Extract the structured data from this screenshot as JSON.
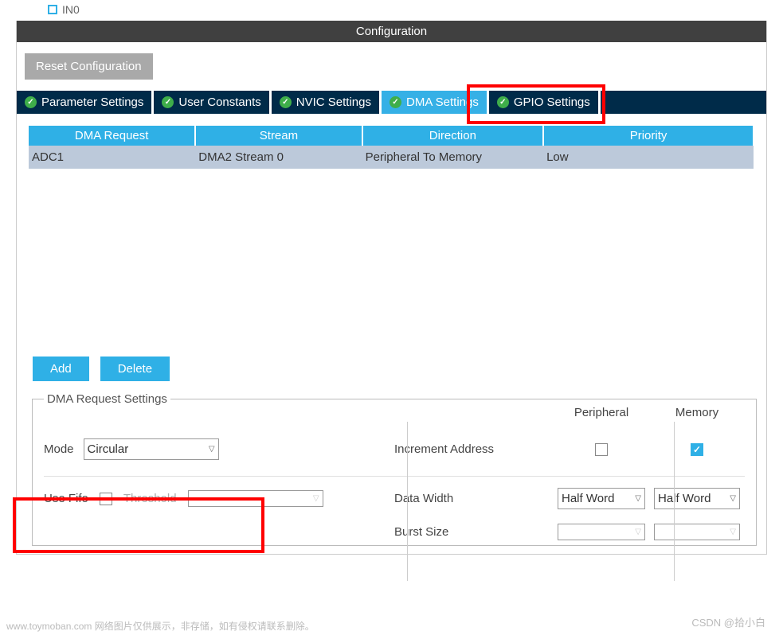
{
  "header": {
    "title": "Configuration"
  },
  "toolbar": {
    "reset_label": "Reset Configuration"
  },
  "tree_stub": {
    "label": "IN0"
  },
  "tabs": [
    {
      "label": "Parameter Settings",
      "selected": false
    },
    {
      "label": "User Constants",
      "selected": false
    },
    {
      "label": "NVIC Settings",
      "selected": false
    },
    {
      "label": "DMA Settings",
      "selected": true
    },
    {
      "label": "GPIO Settings",
      "selected": false
    }
  ],
  "table": {
    "headers": [
      "DMA Request",
      "Stream",
      "Direction",
      "Priority"
    ],
    "rows": [
      {
        "request": "ADC1",
        "stream": "DMA2 Stream 0",
        "direction": "Peripheral To Memory",
        "priority": "Low"
      }
    ]
  },
  "buttons": {
    "add": "Add",
    "delete": "Delete"
  },
  "settings": {
    "legend": "DMA Request Settings",
    "col_peripheral": "Peripheral",
    "col_memory": "Memory",
    "mode_label": "Mode",
    "mode_value": "Circular",
    "increment_label": "Increment Address",
    "increment_peripheral": false,
    "increment_memory": true,
    "use_fifo_label": "Use Fifo",
    "use_fifo_value": false,
    "threshold_label": "Threshold",
    "threshold_value": "",
    "data_width_label": "Data Width",
    "data_width_peripheral": "Half Word",
    "data_width_memory": "Half Word",
    "burst_label": "Burst Size",
    "burst_peripheral": "",
    "burst_memory": ""
  },
  "watermark": {
    "footer": "www.toymoban.com 网络图片仅供展示，非存储，如有侵权请联系删除。",
    "csdn": "CSDN @拾小白"
  }
}
